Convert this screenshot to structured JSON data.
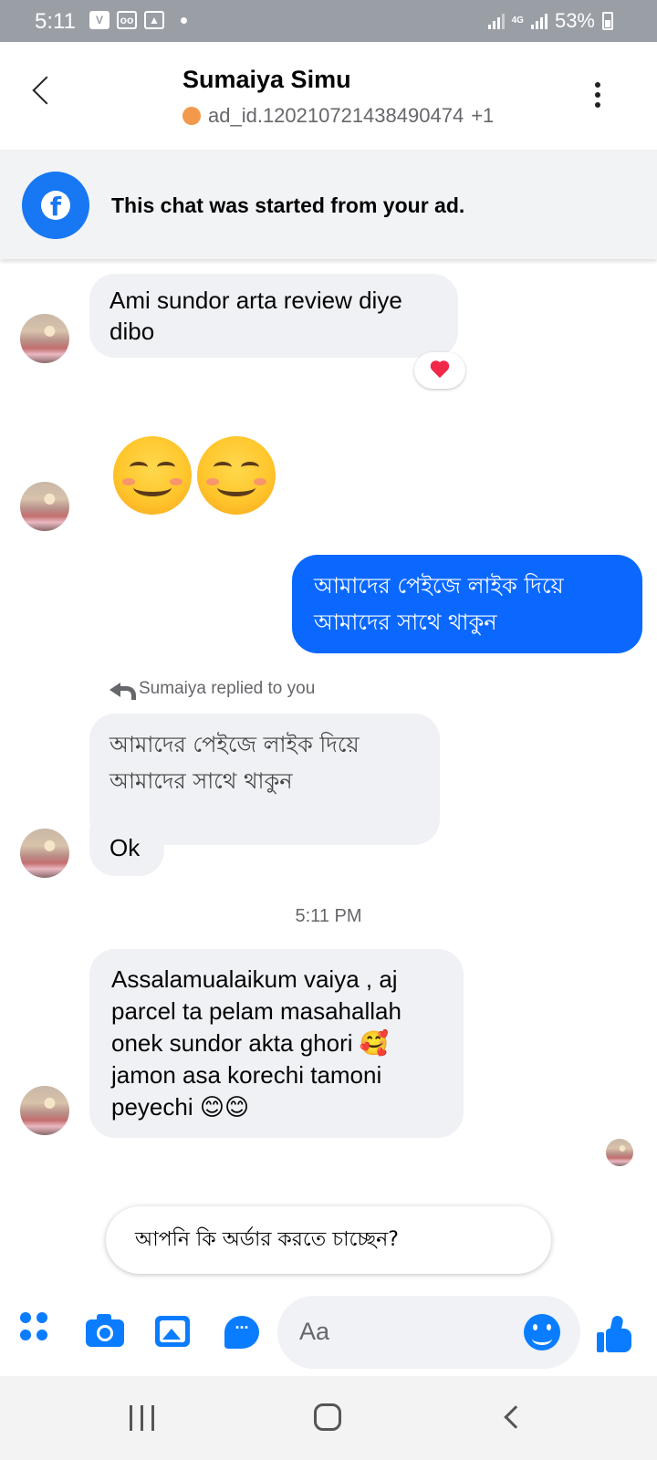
{
  "status_bar": {
    "time": "5:11",
    "battery": "53%",
    "network": "4G"
  },
  "header": {
    "name": "Sumaiya Simu",
    "subtitle": "ad_id.120210721438490474",
    "subtitle_extra": "+1",
    "status_color": "#f3994b"
  },
  "banner": {
    "text": "This chat was started from your ad."
  },
  "messages": {
    "m1": {
      "line1": "Ami sundor arta review diye",
      "line2": "dibo",
      "reaction": "heart"
    },
    "m2": {
      "emoji": "smiling-face-with-smiling-eyes x2"
    },
    "m3_out": {
      "line1": "আমাদের পেইজে লাইক দিয়ে",
      "line2": "আমাদের সাথে থাকুন"
    },
    "reply_label": "Sumaiya replied to you",
    "m4": {
      "quote_line1": "আমাদের পেইজে লাইক দিয়ে",
      "quote_line2": "আমাদের সাথে থাকুন",
      "text": "Ok"
    },
    "timestamp": "5:11 PM",
    "m5": {
      "line1": "Assalamualaikum vaiya , aj",
      "line2": "parcel ta pelam masahallah",
      "line3": "onek sundor akta ghori 🥰",
      "line4": "jamon asa korechi tamoni",
      "line5": "peyechi 😊😊"
    }
  },
  "suggestion": {
    "text": "আপনি কি অর্ডার করতে চাচ্ছেন?"
  },
  "composer": {
    "placeholder": "Aa"
  },
  "colors": {
    "accent": "#0a7cff",
    "outgoing_bubble": "#0a68ff",
    "incoming_bubble": "#f0f1f4"
  }
}
